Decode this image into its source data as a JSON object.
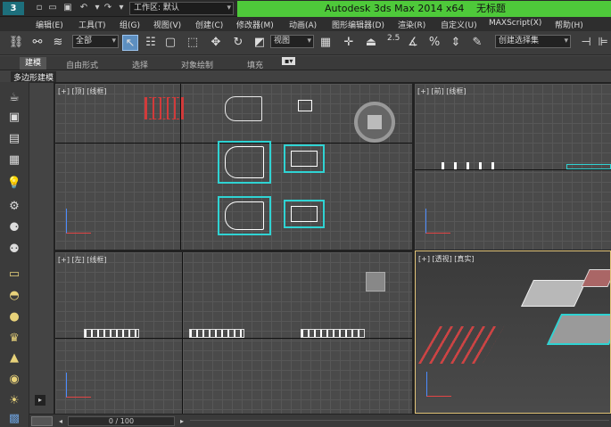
{
  "titlebar": {
    "logo": "3",
    "workspace": "工作区: 默认",
    "app_title": "Autodesk 3ds Max  2014 x64",
    "doc_title": "无标题"
  },
  "menu": [
    "编辑(E)",
    "工具(T)",
    "组(G)",
    "视图(V)",
    "创建(C)",
    "修改器(M)",
    "动画(A)",
    "图形编辑器(D)",
    "渲染(R)",
    "自定义(U)",
    "MAXScript(X)",
    "帮助(H)"
  ],
  "toolbar": {
    "filter": "全部",
    "refcoord": "视图",
    "snap_value": "2.5",
    "selection_set": "创建选择集"
  },
  "ribbon": {
    "tabs": [
      "建模",
      "自由形式",
      "选择",
      "对象绘制",
      "填充"
    ],
    "sub_label": "多边形建模"
  },
  "viewports": {
    "top": "[+] [顶] [线框]",
    "front": "[+] [前] [线框]",
    "left": "[+] [左] [线框]",
    "persp": "[+] [透视] [真实]"
  },
  "timeline": {
    "frame": "0 / 100"
  },
  "colors": {
    "title_green": "#4ec93a",
    "cyan_selection": "#2fd3d3",
    "persp_border": "#e3c57a",
    "red_objects": "#d23b3b"
  }
}
